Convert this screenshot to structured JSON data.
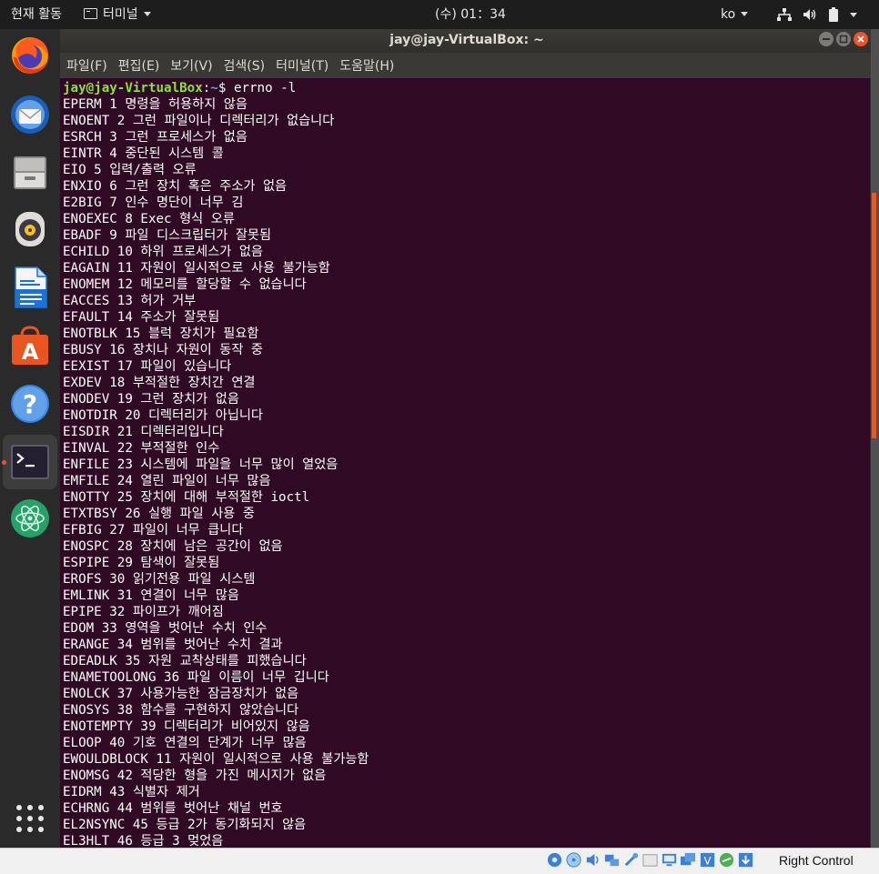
{
  "topbar": {
    "activities": "현재 활동",
    "app_menu": "터미널",
    "clock": "(수) 01：34",
    "language": "ko"
  },
  "dock": {
    "items": [
      {
        "name": "firefox",
        "icon": "firefox-icon"
      },
      {
        "name": "thunderbird",
        "icon": "thunderbird-icon"
      },
      {
        "name": "files",
        "icon": "files-icon"
      },
      {
        "name": "rhythmbox",
        "icon": "rhythmbox-icon"
      },
      {
        "name": "writer",
        "icon": "libreoffice-writer-icon"
      },
      {
        "name": "software",
        "icon": "software-center-icon"
      },
      {
        "name": "help",
        "icon": "help-icon"
      },
      {
        "name": "terminal",
        "icon": "terminal-icon",
        "active": true
      },
      {
        "name": "atom",
        "icon": "atom-icon"
      },
      {
        "name": "show-apps",
        "icon": "app-grid-icon"
      }
    ]
  },
  "window": {
    "title": "jay@jay-VirtualBox: ~",
    "menus": [
      "파일(F)",
      "편집(E)",
      "보기(V)",
      "검색(S)",
      "터미널(T)",
      "도움말(H)"
    ]
  },
  "terminal": {
    "prompt_user": "jay@jay-VirtualBox",
    "prompt_sep": ":",
    "prompt_path": "~",
    "prompt_symbol": "$ ",
    "command": "errno -l",
    "lines": [
      "EPERM 1 명령을 허용하지 않음",
      "ENOENT 2 그런 파일이나 디렉터리가 없습니다",
      "ESRCH 3 그런 프로세스가 없음",
      "EINTR 4 중단된 시스템 콜",
      "EIO 5 입력/출력 오류",
      "ENXIO 6 그런 장치 혹은 주소가 없음",
      "E2BIG 7 인수 명단이 너무 김",
      "ENOEXEC 8 Exec 형식 오류",
      "EBADF 9 파일 디스크립터가 잘못됨",
      "ECHILD 10 하위 프로세스가 없음",
      "EAGAIN 11 자원이 일시적으로 사용 불가능함",
      "ENOMEM 12 메모리를 할당할 수 없습니다",
      "EACCES 13 허가 거부",
      "EFAULT 14 주소가 잘못됨",
      "ENOTBLK 15 블럭 장치가 필요함",
      "EBUSY 16 장치나 자원이 동작 중",
      "EEXIST 17 파일이 있습니다",
      "EXDEV 18 부적절한 장치간 연결",
      "ENODEV 19 그런 장치가 없음",
      "ENOTDIR 20 디렉터리가 아닙니다",
      "EISDIR 21 디렉터리입니다",
      "EINVAL 22 부적절한 인수",
      "ENFILE 23 시스템에 파일을 너무 많이 열었음",
      "EMFILE 24 열린 파일이 너무 많음",
      "ENOTTY 25 장치에 대해 부적절한 ioctl",
      "ETXTBSY 26 실행 파일 사용 중",
      "EFBIG 27 파일이 너무 큽니다",
      "ENOSPC 28 장치에 남은 공간이 없음",
      "ESPIPE 29 탐색이 잘못됨",
      "EROFS 30 읽기전용 파일 시스템",
      "EMLINK 31 연결이 너무 많음",
      "EPIPE 32 파이프가 깨어짐",
      "EDOM 33 영역을 벗어난 수치 인수",
      "ERANGE 34 범위를 벗어난 수치 결과",
      "EDEADLK 35 자원 교착상태를 피했습니다",
      "ENAMETOOLONG 36 파일 이름이 너무 깁니다",
      "ENOLCK 37 사용가능한 잠금장치가 없음",
      "ENOSYS 38 함수를 구현하지 않았습니다",
      "ENOTEMPTY 39 디렉터리가 비어있지 않음",
      "ELOOP 40 기호 연결의 단계가 너무 많음",
      "EWOULDBLOCK 11 자원이 일시적으로 사용 불가능함",
      "ENOMSG 42 적당한 형을 가진 메시지가 없음",
      "EIDRM 43 식별자 제거",
      "ECHRNG 44 범위를 벗어난 채널 번호",
      "EL2NSYNC 45 등급 2가 동기화되지 않음",
      "EL3HLT 46 등급 3 멎었음"
    ]
  },
  "statusbar": {
    "host_key": "Right Control"
  },
  "colors": {
    "terminal_bg": "#300a24",
    "prompt_user": "#8ae234",
    "prompt_path": "#729fcf",
    "accent": "#e9542b"
  }
}
